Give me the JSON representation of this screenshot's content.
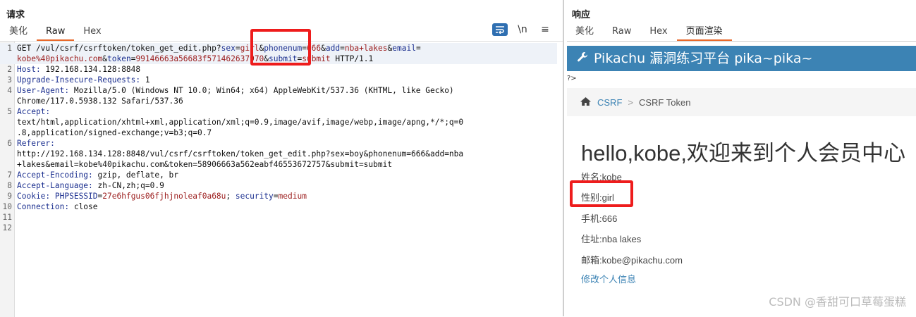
{
  "request": {
    "title": "请求",
    "tabs": [
      "美化",
      "Raw",
      "Hex"
    ],
    "toolbar": {
      "newline_label": "\\n",
      "menu_label": "≡"
    },
    "lines": [
      {
        "n": "1",
        "parts": [
          {
            "t": "GET /vul/csrf/csrftoken/token_get_edit.php?",
            "c": ""
          },
          {
            "t": "sex",
            "c": "k"
          },
          {
            "t": "=",
            "c": ""
          },
          {
            "t": "girl",
            "c": "v"
          },
          {
            "t": "&",
            "c": ""
          },
          {
            "t": "phonenum",
            "c": "k"
          },
          {
            "t": "=",
            "c": ""
          },
          {
            "t": "666",
            "c": "v"
          },
          {
            "t": "&",
            "c": ""
          },
          {
            "t": "add",
            "c": "k"
          },
          {
            "t": "=",
            "c": ""
          },
          {
            "t": "nba+lakes",
            "c": "v"
          },
          {
            "t": "&",
            "c": ""
          },
          {
            "t": "email",
            "c": "k"
          },
          {
            "t": "=",
            "c": ""
          }
        ]
      },
      {
        "n": "",
        "parts": [
          {
            "t": "kobe%40pikachu.com",
            "c": "v"
          },
          {
            "t": "&",
            "c": ""
          },
          {
            "t": "token",
            "c": "k"
          },
          {
            "t": "=",
            "c": ""
          },
          {
            "t": "99146663a56683f571462637970",
            "c": "v"
          },
          {
            "t": "&",
            "c": ""
          },
          {
            "t": "submit",
            "c": "k"
          },
          {
            "t": "=",
            "c": ""
          },
          {
            "t": "submit",
            "c": "v"
          },
          {
            "t": " HTTP/1.1",
            "c": ""
          }
        ]
      },
      {
        "n": "2",
        "parts": [
          {
            "t": "Host:",
            "c": "h"
          },
          {
            "t": " 192.168.134.128:8848",
            "c": ""
          }
        ]
      },
      {
        "n": "3",
        "parts": [
          {
            "t": "Upgrade-Insecure-Requests:",
            "c": "h"
          },
          {
            "t": " 1",
            "c": ""
          }
        ]
      },
      {
        "n": "4",
        "parts": [
          {
            "t": "User-Agent:",
            "c": "h"
          },
          {
            "t": " Mozilla/5.0 (Windows NT 10.0; Win64; x64) AppleWebKit/537.36 (KHTML, like Gecko)",
            "c": ""
          }
        ]
      },
      {
        "n": "",
        "parts": [
          {
            "t": "Chrome/117.0.5938.132 Safari/537.36",
            "c": ""
          }
        ]
      },
      {
        "n": "5",
        "parts": [
          {
            "t": "Accept:",
            "c": "h"
          }
        ]
      },
      {
        "n": "",
        "parts": [
          {
            "t": "text/html,application/xhtml+xml,application/xml;q=0.9,image/avif,image/webp,image/apng,*/*;q=0",
            "c": ""
          }
        ]
      },
      {
        "n": "",
        "parts": [
          {
            "t": ".8,application/signed-exchange;v=b3;q=0.7",
            "c": ""
          }
        ]
      },
      {
        "n": "6",
        "parts": [
          {
            "t": "Referer:",
            "c": "h"
          }
        ]
      },
      {
        "n": "",
        "parts": [
          {
            "t": "http://192.168.134.128:8848/vul/csrf/csrftoken/token_get_edit.php?sex=boy&phonenum=666&add=nba",
            "c": ""
          }
        ]
      },
      {
        "n": "",
        "parts": [
          {
            "t": "+lakes&email=kobe%40pikachu.com&token=58906663a562eabf46553672757&submit=submit",
            "c": ""
          }
        ]
      },
      {
        "n": "7",
        "parts": [
          {
            "t": "Accept-Encoding:",
            "c": "h"
          },
          {
            "t": " gzip, deflate, br",
            "c": ""
          }
        ]
      },
      {
        "n": "8",
        "parts": [
          {
            "t": "Accept-Language:",
            "c": "h"
          },
          {
            "t": " zh-CN,zh;q=0.9",
            "c": ""
          }
        ]
      },
      {
        "n": "9",
        "parts": [
          {
            "t": "Cookie:",
            "c": "h"
          },
          {
            "t": " ",
            "c": ""
          },
          {
            "t": "PHPSESSID",
            "c": "k"
          },
          {
            "t": "=",
            "c": ""
          },
          {
            "t": "27e6hfgus06fjhjnoleaf0a68u",
            "c": "v"
          },
          {
            "t": "; ",
            "c": ""
          },
          {
            "t": "security",
            "c": "k"
          },
          {
            "t": "=",
            "c": ""
          },
          {
            "t": "medium",
            "c": "v"
          }
        ]
      },
      {
        "n": "10",
        "parts": [
          {
            "t": "Connection:",
            "c": "h"
          },
          {
            "t": " close",
            "c": ""
          }
        ]
      },
      {
        "n": "11",
        "parts": []
      },
      {
        "n": "12",
        "parts": []
      }
    ]
  },
  "response": {
    "title": "响应",
    "tabs": [
      "美化",
      "Raw",
      "Hex",
      "页面渲染"
    ],
    "banner": "Pikachu 漏洞练习平台 pika~pika~",
    "stray_text": "?>",
    "breadcrumb": {
      "link": "CSRF",
      "sep": ">",
      "current": "CSRF Token"
    },
    "greeting": "hello,kobe,欢迎来到个人会员中心",
    "fields": [
      "姓名:kobe",
      "性别:girl",
      "手机:666",
      "住址:nba lakes",
      "邮箱:kobe@pikachu.com"
    ],
    "edit_link": "修改个人信息"
  },
  "watermark": "CSDN @香甜可口草莓蛋糕",
  "colors": {
    "accent_tab": "#e8692b",
    "banner": "#3c83b4",
    "highlight_box": "#ee1c1c",
    "param_name": "#1b2f8f",
    "param_value": "#9b1c1c"
  }
}
